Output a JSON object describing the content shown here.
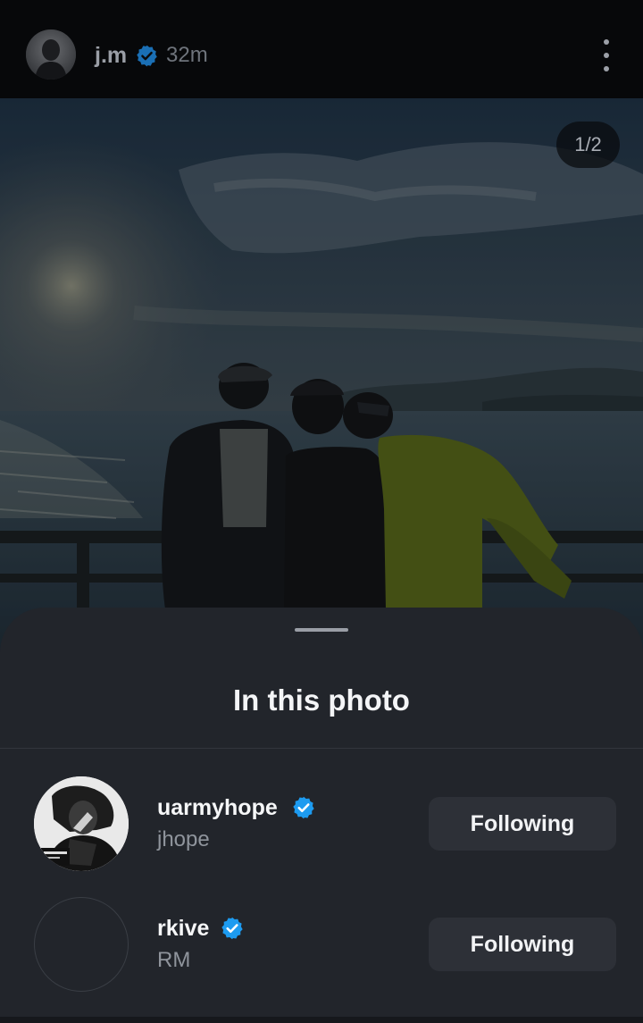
{
  "header": {
    "username": "j.m",
    "verified": true,
    "time_ago": "32m",
    "avatar_icon": "profile-photo",
    "more_icon": "more-vertical-icon"
  },
  "photo": {
    "counter": "1/2"
  },
  "sheet": {
    "title": "In this photo",
    "people": [
      {
        "username": "uarmyhope",
        "display_name": "jhope",
        "verified": true,
        "button_label": "Following"
      },
      {
        "username": "rkive",
        "display_name": "RM",
        "verified": true,
        "button_label": "Following"
      }
    ]
  },
  "colors": {
    "verified_badge": "#1d9bf0",
    "sheet_bg": "#22252b",
    "button_bg": "#2d3037"
  }
}
